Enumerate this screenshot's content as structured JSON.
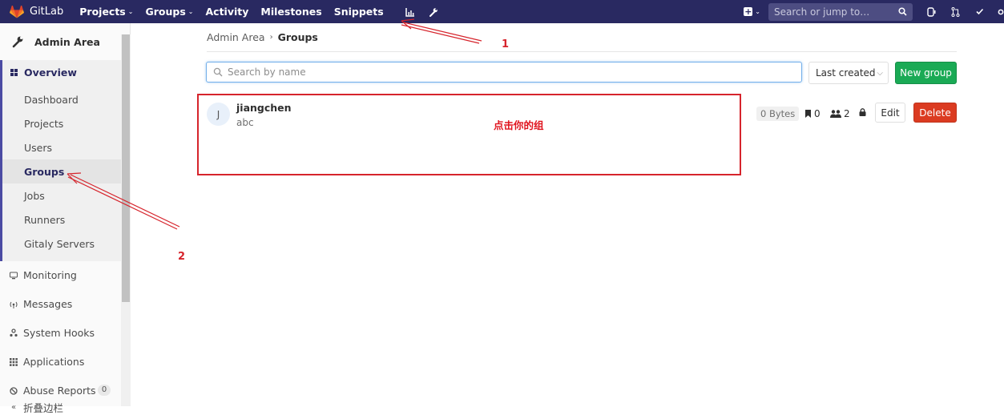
{
  "navbar": {
    "brand": "GitLab",
    "links": [
      {
        "label": "Projects",
        "dropdown": true
      },
      {
        "label": "Groups",
        "dropdown": true
      },
      {
        "label": "Activity",
        "dropdown": false
      },
      {
        "label": "Milestones",
        "dropdown": false
      },
      {
        "label": "Snippets",
        "dropdown": false
      }
    ],
    "search_placeholder": "Search or jump to…",
    "icons": [
      "chart-icon",
      "wrench-icon",
      "plus-square-icon",
      "issues-icon",
      "merge-request-icon",
      "todo-icon"
    ]
  },
  "sidebar": {
    "title": "Admin Area",
    "overview": {
      "label": "Overview",
      "items": [
        "Dashboard",
        "Projects",
        "Users",
        "Groups",
        "Jobs",
        "Runners",
        "Gitaly Servers"
      ],
      "active": "Groups"
    },
    "items": [
      {
        "label": "Monitoring",
        "icon": "monitor-icon"
      },
      {
        "label": "Messages",
        "icon": "broadcast-icon"
      },
      {
        "label": "System Hooks",
        "icon": "hook-icon"
      },
      {
        "label": "Applications",
        "icon": "apps-icon"
      },
      {
        "label": "Abuse Reports",
        "icon": "abuse-icon",
        "count": "0"
      }
    ],
    "collapse_label": "折叠边栏"
  },
  "main": {
    "breadcrumb": {
      "parent": "Admin Area",
      "current": "Groups"
    },
    "search_placeholder": "Search by name",
    "sort_label": "Last created",
    "new_group_label": "New group",
    "groups": [
      {
        "initial": "J",
        "name": "jiangchen",
        "description": "abc",
        "size": "0 Bytes",
        "projects": "0",
        "members": "2",
        "edit_label": "Edit",
        "delete_label": "Delete"
      }
    ]
  },
  "annotations": {
    "label_1": "1",
    "label_2": "2",
    "note": "点击你的组",
    "color": "#d6242c"
  },
  "colors": {
    "navbar": "#292961",
    "primary_green": "#1aaa55",
    "danger_red": "#db3b21",
    "focus_blue": "#73afea"
  }
}
